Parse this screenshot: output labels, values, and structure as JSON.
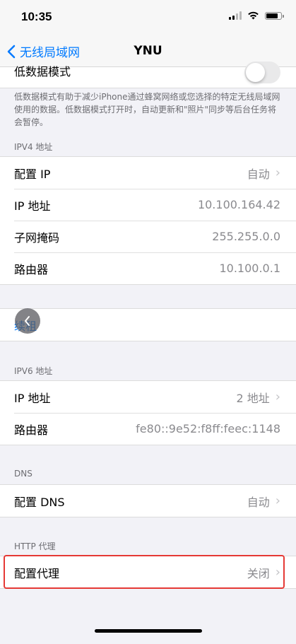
{
  "status_bar": {
    "time": "10:35"
  },
  "nav": {
    "back_label": "无线局域网",
    "title": "YNU"
  },
  "low_data": {
    "label": "低数据模式",
    "enabled": false,
    "footer": "低数据模式有助于减少iPhone通过蜂窝网络或您选择的特定无线局域网使用的数据。低数据模式打开时，自动更新和\"照片\"同步等后台任务将会暂停。"
  },
  "ipv4": {
    "header": "IPV4 地址",
    "rows": [
      {
        "label": "配置 IP",
        "value": "自动"
      },
      {
        "label": "IP 地址",
        "value": "10.100.164.42"
      },
      {
        "label": "子网掩码",
        "value": "255.255.0.0"
      },
      {
        "label": "路由器",
        "value": "10.100.0.1"
      }
    ]
  },
  "renew": {
    "label": "续租"
  },
  "ipv6": {
    "header": "IPV6 地址",
    "rows": [
      {
        "label": "IP 地址",
        "value": "2 地址"
      },
      {
        "label": "路由器",
        "value": "fe80::9e52:f8ff:feec:1148"
      }
    ]
  },
  "dns": {
    "header": "DNS",
    "rows": [
      {
        "label": "配置 DNS",
        "value": "自动"
      }
    ]
  },
  "http_proxy": {
    "header": "HTTP 代理",
    "rows": [
      {
        "label": "配置代理",
        "value": "关闭"
      }
    ]
  },
  "colors": {
    "accent": "#007aff",
    "highlight_border": "#e53935"
  },
  "icons": {
    "back": "chevron-left-icon",
    "disclosure": "chevron-right-icon",
    "float": "chevron-left-icon"
  }
}
